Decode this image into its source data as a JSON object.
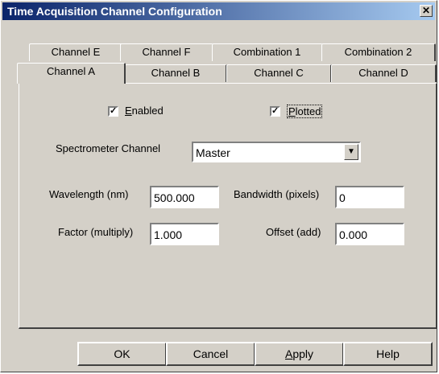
{
  "window": {
    "title": "Time Acquisition Channel Configuration",
    "close_glyph": "✕"
  },
  "tabs_back": [
    "Channel E",
    "Channel F",
    "Combination 1",
    "Combination 2"
  ],
  "tabs_front": [
    "Channel A",
    "Channel B",
    "Channel C",
    "Channel D"
  ],
  "active_tab": "Channel A",
  "options": {
    "enabled": {
      "label_first": "E",
      "label_rest": "nabled",
      "checked": true
    },
    "plotted": {
      "label_first": "P",
      "label_rest": "lotted",
      "checked": true
    }
  },
  "spectrometer": {
    "label": "Spectrometer Channel",
    "value": "Master",
    "arrow_glyph": "▼"
  },
  "fields": {
    "wavelength": {
      "label": "Wavelength (nm)",
      "value": "500.000"
    },
    "bandwidth": {
      "label": "Bandwidth (pixels)",
      "value": "0"
    },
    "factor": {
      "label": "Factor (multiply)",
      "value": "1.000"
    },
    "offset": {
      "label": "Offset (add)",
      "value": "0.000"
    }
  },
  "buttons": {
    "ok": "OK",
    "cancel": "Cancel",
    "apply_first": "A",
    "apply_rest": "pply",
    "help": "Help"
  },
  "check_glyph": "✓"
}
